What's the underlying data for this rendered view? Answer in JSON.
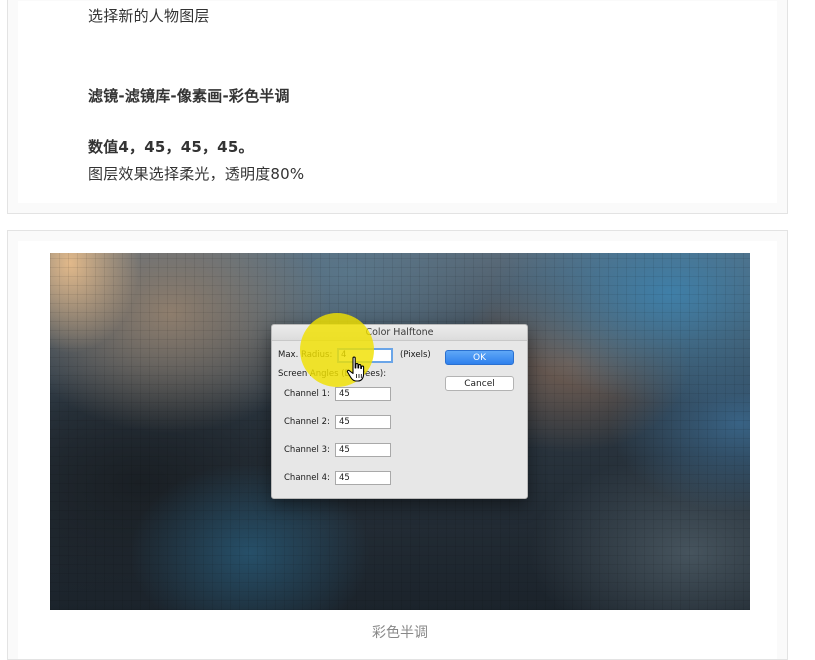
{
  "article": {
    "lines": [
      "选择新的人物图层",
      "滤镜-滤镜库-像素画-彩色半调",
      "数值4，45，45，45。",
      "图层效果选择柔光，透明度80%"
    ]
  },
  "dialog": {
    "title": "Color Halftone",
    "max_radius_label": "Max. Radius:",
    "max_radius_value": "4",
    "pixels_label": "(Pixels)",
    "screen_angles_label": "Screen Angles (Degrees):",
    "channels": [
      {
        "label": "Channel 1:",
        "value": "45"
      },
      {
        "label": "Channel 2:",
        "value": "45"
      },
      {
        "label": "Channel 3:",
        "value": "45"
      },
      {
        "label": "Channel 4:",
        "value": "45"
      }
    ],
    "ok_label": "OK",
    "cancel_label": "Cancel"
  },
  "caption": "彩色半调",
  "icons": [
    "hand-pointer-icon"
  ],
  "colors": {
    "highlight": "#f0e000",
    "ok_button": "#2f80ed",
    "focus_ring": "#6aa5e8"
  }
}
